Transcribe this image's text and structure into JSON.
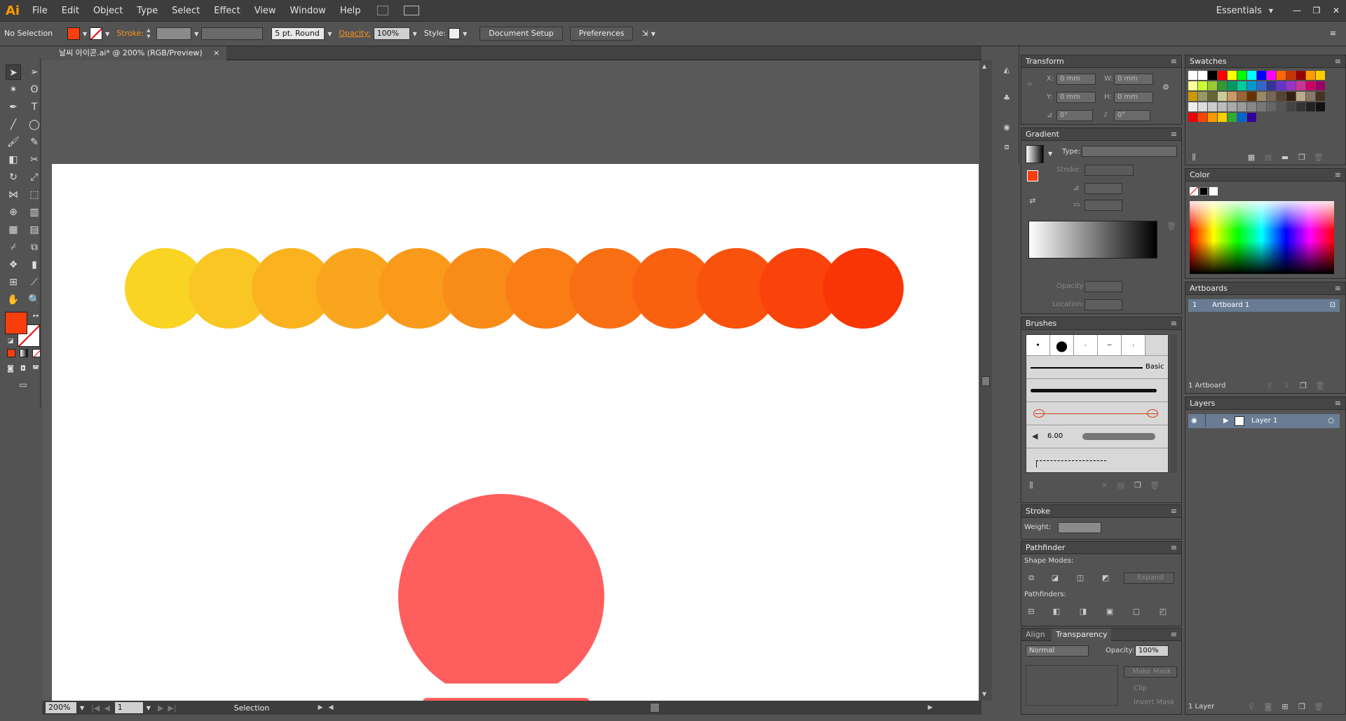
{
  "app": {
    "logo": "Ai",
    "workspace": "Essentials"
  },
  "menu": [
    "File",
    "Edit",
    "Object",
    "Type",
    "Select",
    "Effect",
    "View",
    "Window",
    "Help"
  ],
  "control": {
    "selection": "No Selection",
    "stroke_label": "Stroke:",
    "brush": "5 pt. Round",
    "opacity_label": "Opacity:",
    "opacity": "100%",
    "style_label": "Style:",
    "doc_setup": "Document Setup",
    "preferences": "Preferences",
    "fill_color": "#f93e0d"
  },
  "document": {
    "tab": "날씨 아이콘.ai* @ 200% (RGB/Preview)",
    "zoom": "200%",
    "artboard_nav": "1",
    "status": "Selection",
    "circle_colors": [
      "#f9d423",
      "#f9c623",
      "#fab31f",
      "#f9a61e",
      "#f99a1b",
      "#f98b18",
      "#f97c15",
      "#f96e13",
      "#f96110",
      "#f9520d",
      "#f9430a",
      "#f93505"
    ],
    "sun_color": "#ff5e5e"
  },
  "panels": {
    "transform": {
      "title": "Transform",
      "x_label": "X:",
      "x": "0 mm",
      "y_label": "Y:",
      "y": "0 mm",
      "w_label": "W:",
      "w": "0 mm",
      "h_label": "H:",
      "h": "0 mm",
      "rot": "0°",
      "shear": "0°"
    },
    "gradient": {
      "title": "Gradient",
      "type_label": "Type:",
      "stroke_label": "Stroke:",
      "opacity_label": "Opacity:",
      "location_label": "Location:"
    },
    "brushes": {
      "title": "Brushes",
      "basic": "Basic",
      "size": "6.00"
    },
    "stroke": {
      "title": "Stroke",
      "weight_label": "Weight:"
    },
    "pathfinder": {
      "title": "Pathfinder",
      "shape_modes": "Shape Modes:",
      "expand": "Expand",
      "pathfinders": "Pathfinders:"
    },
    "transparency": {
      "align_tab": "Align",
      "title": "Transparency",
      "blend": "Normal",
      "opacity_label": "Opacity:",
      "opacity": "100%",
      "make_mask": "Make Mask",
      "clip": "Clip",
      "invert": "Invert Mask"
    },
    "swatches": {
      "title": "Swatches"
    },
    "color": {
      "title": "Color"
    },
    "artboards": {
      "title": "Artboards",
      "row_num": "1",
      "row_name": "Artboard 1",
      "footer": "1 Artboard"
    },
    "layers": {
      "title": "Layers",
      "layer_name": "Layer 1",
      "footer": "1 Layer"
    }
  }
}
